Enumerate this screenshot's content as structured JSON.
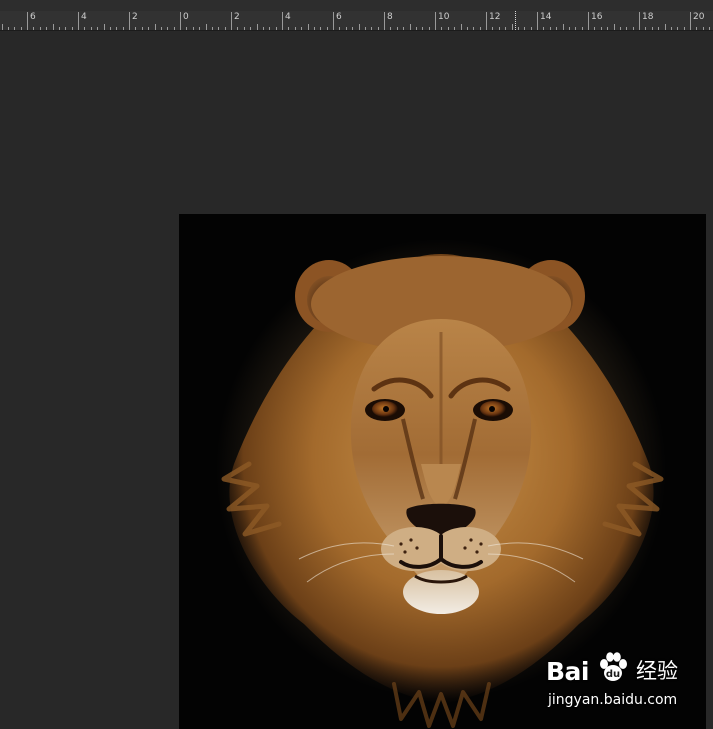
{
  "ruler": {
    "labels": [
      {
        "text": "6",
        "value": -6
      },
      {
        "text": "4",
        "value": -4
      },
      {
        "text": "2",
        "value": -2
      },
      {
        "text": "0",
        "value": 0
      },
      {
        "text": "2",
        "value": 2
      },
      {
        "text": "4",
        "value": 4
      },
      {
        "text": "6",
        "value": 6
      },
      {
        "text": "8",
        "value": 8
      },
      {
        "text": "10",
        "value": 10
      },
      {
        "text": "12",
        "value": 12
      },
      {
        "text": "14",
        "value": 14
      },
      {
        "text": "16",
        "value": 16
      },
      {
        "text": "18",
        "value": 18
      },
      {
        "text": "20",
        "value": 20
      }
    ]
  },
  "canvas": {
    "background": "#030303",
    "subject": "lion-face-icon"
  },
  "watermark": {
    "brand_text": "Bai",
    "brand_paw_icon": "baidu-paw-icon",
    "suffix_text": "经验",
    "url_text": "jingyan.baidu.com"
  },
  "colors": {
    "app_background": "#282828",
    "ruler_background": "#323232",
    "ruler_text": "#cfcfcf",
    "mane": "#b8813f",
    "eye": "#8a4a14"
  }
}
